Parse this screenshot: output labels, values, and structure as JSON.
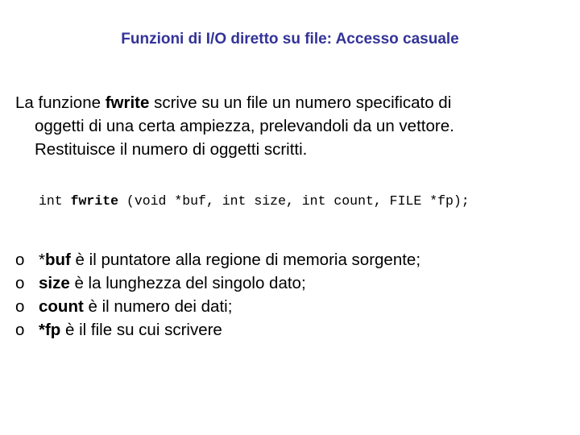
{
  "slide": {
    "title": "Funzioni di I/O diretto su file: Accesso casuale",
    "title_color": "#333399",
    "paragraph": {
      "line1_prefix": "La funzione ",
      "line1_bold": "fwrite",
      "line1_suffix": " scrive su un file un numero specificato di",
      "line2": "oggetti di una certa ampiezza, prelevandoli da un vettore.",
      "line3": "Restituisce il numero di oggetti scritti."
    },
    "code": {
      "prefix": "int ",
      "bold": "fwrite",
      "suffix": " (void *buf, int size, int count, FILE *fp);"
    },
    "bullets": [
      {
        "marker": "o",
        "plain_prefix": "*",
        "bold": "buf",
        "text": " è il puntatore alla regione di memoria sorgente;"
      },
      {
        "marker": "o",
        "plain_prefix": "",
        "bold": "size",
        "text": " è la lunghezza del singolo dato;"
      },
      {
        "marker": "o",
        "plain_prefix": "",
        "bold": "count",
        "text": " è il numero dei dati;"
      },
      {
        "marker": "o",
        "plain_prefix": "",
        "bold": "*fp",
        "text": " è il file su cui scrivere"
      }
    ]
  }
}
